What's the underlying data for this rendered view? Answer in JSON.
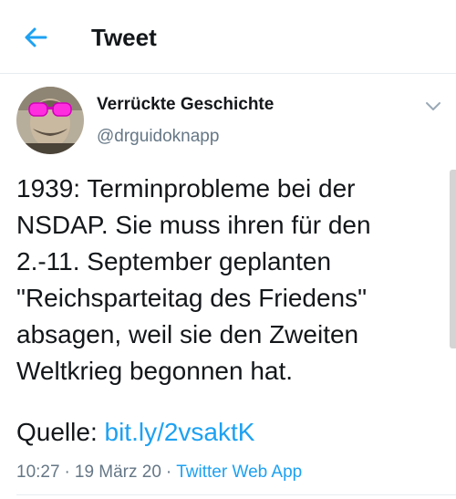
{
  "header": {
    "back_icon": "arrow-left-icon",
    "title": "Tweet"
  },
  "tweet": {
    "author": {
      "name": "Verrückte Geschichte",
      "handle": "@drguidoknapp"
    },
    "menu_icon": "chevron-down-icon",
    "text": "1939: Terminprobleme bei der\nNSDAP. Sie muss ihren für den\n2.-11. September geplanten\n\"Reichsparteitag des Friedens\"\nabsagen, weil sie den Zweiten\nWeltkrieg begonnen hat.",
    "source_label": "Quelle:",
    "source_link": "bit.ly/2vsaktK",
    "time": "10:27",
    "date": "19 März 20",
    "app": "Twitter Web App",
    "separator": "·"
  },
  "colors": {
    "accent": "#1da1f2",
    "secondary_text": "#657786",
    "divider": "#e6ecf0"
  }
}
